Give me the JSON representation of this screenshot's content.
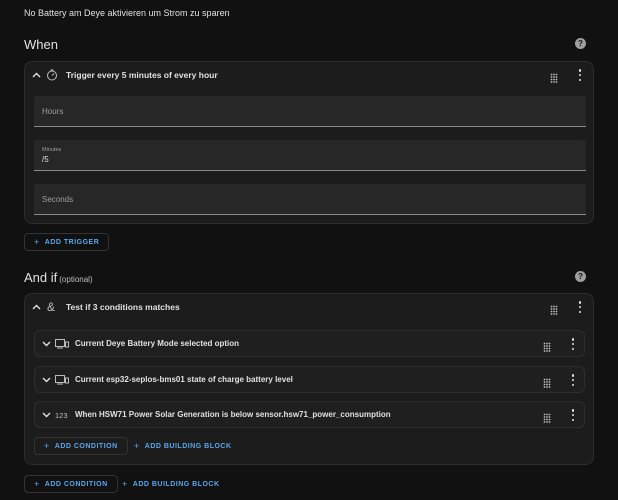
{
  "description": "No Battery am Deye aktivieren um Strom zu sparen",
  "when": {
    "title": "When",
    "help": "?",
    "trigger": {
      "label": "Trigger every 5 minutes of every hour",
      "fields": {
        "hours_placeholder": "Hours",
        "minutes_label": "Minutes",
        "minutes_value": "/5",
        "seconds_placeholder": "Seconds"
      }
    },
    "add_trigger": "ADD TRIGGER"
  },
  "and_if": {
    "title": "And if",
    "optional": "(optional)",
    "help": "?",
    "condition_block": {
      "label": "Test if 3 conditions matches",
      "conditions": [
        {
          "label": "Current Deye Battery Mode selected option",
          "icon": "device-icon"
        },
        {
          "label": "Current esp32-seplos-bms01 state of charge battery level",
          "icon": "device-icon"
        },
        {
          "label": "When HSW71 Power Solar Generation is below sensor.hsw71_power_consumption",
          "icon": "numeric-icon",
          "icon_text": "123"
        }
      ],
      "add_condition": "ADD CONDITION",
      "add_building_block": "ADD BUILDING BLOCK"
    },
    "add_condition": "ADD CONDITION",
    "add_building_block": "ADD BUILDING BLOCK"
  },
  "colors": {
    "background": "#111111",
    "card": "#1c1c1c",
    "accent": "#5aa6ec",
    "text": "#e1e1e1"
  }
}
